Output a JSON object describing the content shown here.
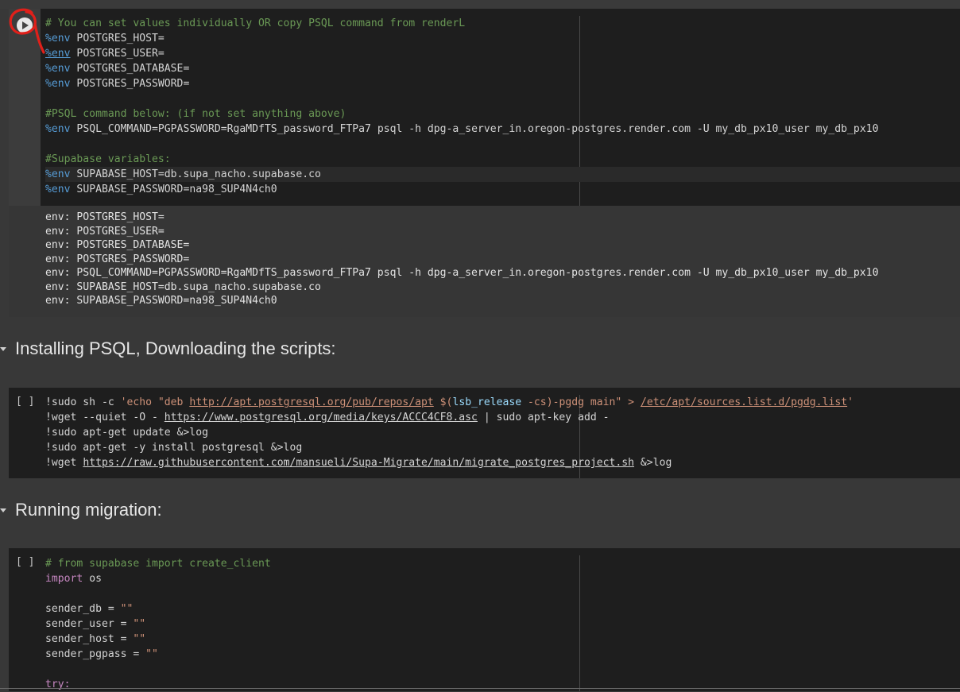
{
  "cell1": {
    "comment1": "# You can set values individually OR copy PSQL command from renderL",
    "env_kw": "%env",
    "env1": " POSTGRES_HOST=",
    "env2": " POSTGRES_USER=",
    "env3": " POSTGRES_DATABASE=",
    "env4": " POSTGRES_PASSWORD=",
    "comment2": "#PSQL command below: (if not set anything above)",
    "env5": " PSQL_COMMAND=PGPASSWORD=RgaMDfTS_password_FTPa7 psql -h dpg-a_server_in.oregon-postgres.render.com -U my_db_px10_user my_db_px10",
    "comment3": "#Supabase variables:",
    "env6": " SUPABASE_HOST=db.supa_nacho.supabase.co",
    "env7": " SUPABASE_PASSWORD=na98_SUP4N4ch0"
  },
  "output1": [
    "env: POSTGRES_HOST=",
    "env: POSTGRES_USER=",
    "env: POSTGRES_DATABASE=",
    "env: POSTGRES_PASSWORD=",
    "env: PSQL_COMMAND=PGPASSWORD=RgaMDfTS_password_FTPa7 psql -h dpg-a_server_in.oregon-postgres.render.com -U my_db_px10_user my_db_px10",
    "env: SUPABASE_HOST=db.supa_nacho.supabase.co",
    "env: SUPABASE_PASSWORD=na98_SUP4N4ch0"
  ],
  "section1": "Installing PSQL, Downloading the scripts:",
  "section2": "Running migration:",
  "cell2": {
    "bracket": "[ ]",
    "l1a": "!sudo sh -c ",
    "l1b": "'echo \"deb ",
    "l1url": "http://apt.postgresql.org/pub/repos/apt",
    "l1c": " $(",
    "l1d": "lsb_release",
    "l1e": " -cs",
    "l1f": ")-pgdg main\" > ",
    "l1url2": "/etc/apt/sources.list.d/pgdg.list",
    "l1g": "'",
    "l2a": "!wget --quiet -O - ",
    "l2url": "https://www.postgresql.org/media/keys/ACCC4CF8.asc",
    "l2b": " | sudo apt-key add -",
    "l3": "!sudo apt-get update &>log",
    "l4": "!sudo apt-get -y install postgresql &>log",
    "l5a": "!wget ",
    "l5url": "https://raw.githubusercontent.com/mansueli/Supa-Migrate/main/migrate_postgres_project.sh",
    "l5b": " &>log"
  },
  "cell3": {
    "bracket": "[ ]",
    "l1": "# from supabase import create_client",
    "l2kw": "import",
    "l2b": " os",
    "l3a": "sender_db = ",
    "l4a": "sender_user = ",
    "l5a": "sender_host = ",
    "l6a": "sender_pgpass = ",
    "empty_str": "\"\"",
    "l7": "try:"
  },
  "colors": {
    "comment": "#6a9955",
    "magic": "#569cd6",
    "keyword": "#c586c0",
    "string": "#ce9178",
    "annotation": "#e0201a"
  }
}
